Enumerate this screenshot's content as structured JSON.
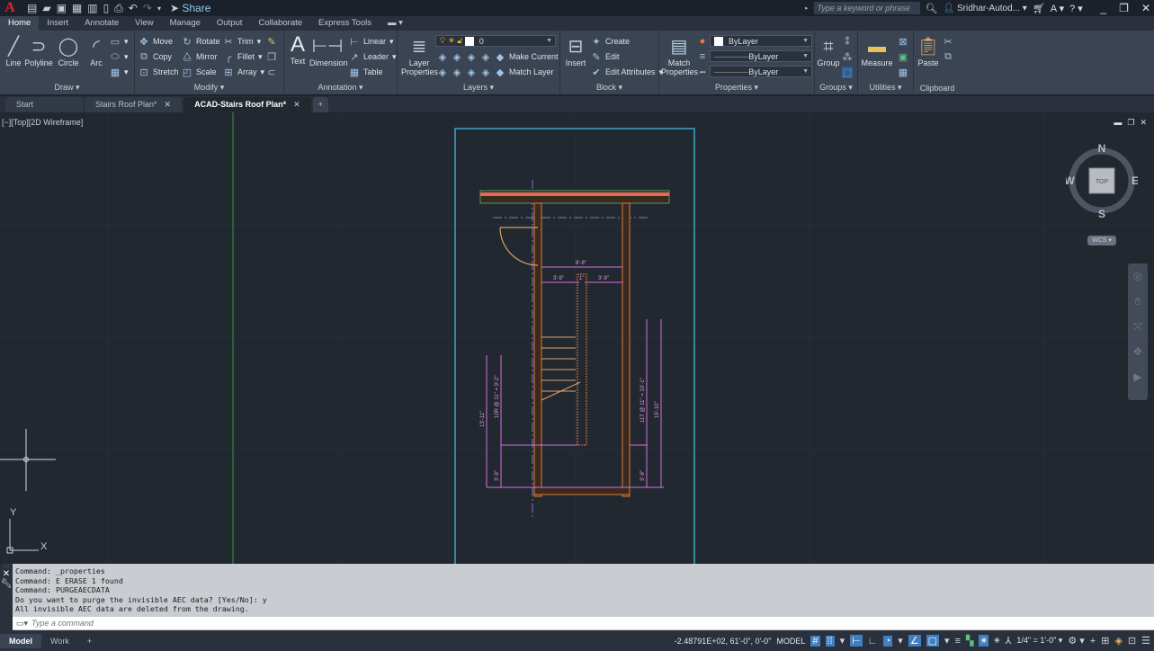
{
  "app": {
    "logo": "A",
    "quick_access": [
      "new-icon",
      "open-icon",
      "save-icon",
      "saveas-icon",
      "plot-preview-icon",
      "mobile-icon",
      "print-icon",
      "undo-icon",
      "redo-icon",
      "customize-icon"
    ],
    "share_label": "Share",
    "search_placeholder": "Type a keyword or phrase",
    "user_name": "Sridhar-Autod...",
    "window_controls": [
      "_",
      "❐",
      "✕"
    ]
  },
  "ribbon_tabs": [
    {
      "label": "Home",
      "active": true
    },
    {
      "label": "Insert"
    },
    {
      "label": "Annotate"
    },
    {
      "label": "View"
    },
    {
      "label": "Manage"
    },
    {
      "label": "Output"
    },
    {
      "label": "Collaborate"
    },
    {
      "label": "Express Tools"
    }
  ],
  "ribbon": {
    "draw": {
      "title": "Draw",
      "line": "Line",
      "polyline": "Polyline",
      "circle": "Circle",
      "arc": "Arc"
    },
    "modify": {
      "title": "Modify",
      "move": "Move",
      "rotate": "Rotate",
      "trim": "Trim",
      "copy": "Copy",
      "mirror": "Mirror",
      "fillet": "Fillet",
      "stretch": "Stretch",
      "scale": "Scale",
      "array": "Array"
    },
    "annotation": {
      "title": "Annotation",
      "text": "Text",
      "dimension": "Dimension",
      "linear": "Linear",
      "leader": "Leader",
      "table": "Table"
    },
    "layers": {
      "title": "Layers",
      "layer_properties_1": "Layer",
      "layer_properties_2": "Properties",
      "current_layer": "0",
      "make_current": "Make Current",
      "match_layer": "Match Layer"
    },
    "block": {
      "title": "Block",
      "insert": "Insert",
      "create": "Create",
      "edit": "Edit",
      "edit_attributes": "Edit Attributes"
    },
    "properties": {
      "title": "Properties",
      "match_1": "Match",
      "match_2": "Properties",
      "color": "ByLayer",
      "lineweight": "ByLayer",
      "linetype": "ByLayer"
    },
    "groups": {
      "title": "Groups",
      "group": "Group"
    },
    "utilities": {
      "title": "Utilities",
      "measure": "Measure"
    },
    "clipboard": {
      "title": "Clipboard",
      "paste": "Paste"
    }
  },
  "doc_tabs": [
    {
      "label": "Start"
    },
    {
      "label": "Stairs Roof Plan*",
      "closable": true
    },
    {
      "label": "ACAD-Stairs Roof Plan*",
      "closable": true,
      "active": true
    }
  ],
  "viewport": {
    "label": "[−][Top][2D Wireframe]",
    "viewcube": {
      "n": "N",
      "s": "S",
      "e": "E",
      "w": "W",
      "face": "TOP"
    },
    "wcs": "WCS",
    "ucs_x": "X",
    "ucs_y": "Y",
    "dims": {
      "top_overall": "8'-8\"",
      "top_left": "3'-9\"",
      "top_mid": "1\"",
      "top_right": "3'-9\"",
      "left_overall": "13'-11\"",
      "left_run": "10R @ 11\" = 9'-2\"",
      "left_bottom": "3'-9\"",
      "right_run": "11T @ 11\" = 10'-1\"",
      "right_overall": "15'-10\"",
      "right_bottom": "3'-9\""
    },
    "colors": {
      "sheet": "#3fa6c8",
      "wall": "#e07a3a",
      "dim": "#d86fe0",
      "center": "#8a6fd0",
      "green_axis": "#2f9e3a"
    }
  },
  "command": {
    "history": [
      "Command: _properties",
      "Command: E ERASE 1 found",
      "Command: PURGEAECDATA",
      "Do you want to purge the invisible AEC data? [Yes/No]: y",
      "All invisible AEC data are deleted from the drawing."
    ],
    "placeholder": "Type a command"
  },
  "layout_tabs": [
    {
      "label": "Model",
      "active": true
    },
    {
      "label": "Work"
    }
  ],
  "status": {
    "coords": "-2.48791E+02, 61'-0\", 0'-0\"",
    "space": "MODEL",
    "scale": "1/4\" = 1'-0\""
  }
}
